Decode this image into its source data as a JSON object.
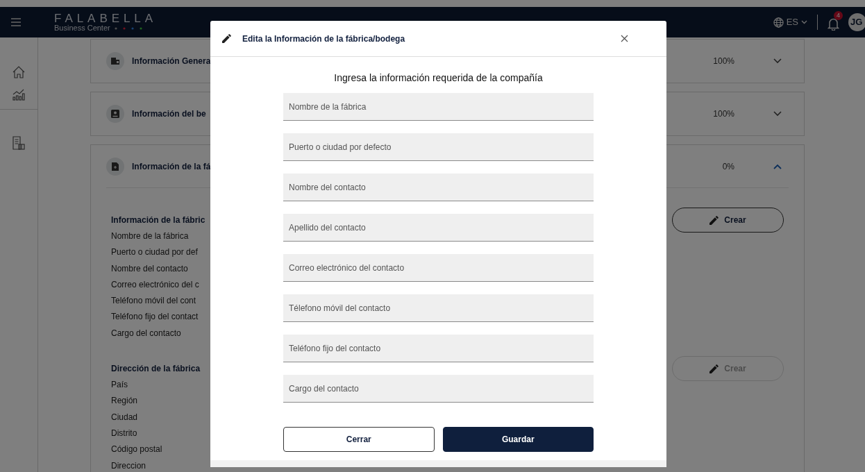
{
  "header": {
    "wordmark": "FALABELLA",
    "tagline": "Business Center",
    "language": "ES",
    "notifications": "4",
    "avatar": "JG"
  },
  "accordion": [
    {
      "title": "Información Genera",
      "progress": "100%",
      "expanded": false
    },
    {
      "title": "Información del be",
      "progress": "100%",
      "expanded": false
    },
    {
      "title": "Información de la fá",
      "progress": "0%",
      "expanded": true,
      "sections": [
        {
          "heading": "Información de la fábric",
          "rows": [
            "Nombre de la fábrica",
            "Puerto o ciudad por def",
            "Nombre del contacto",
            "Correo electrónico del c",
            "Teléfono móvil del cont",
            "Teléfono fijo del contact",
            "Cargo del contacto"
          ],
          "button": {
            "label": "Crear",
            "disabled": false
          }
        },
        {
          "heading": "Dirección de la fábrica",
          "rows": [
            "País",
            "Región",
            "Ciudad",
            "Distrito",
            "Código postal",
            "Direccion"
          ],
          "button": {
            "label": "Crear",
            "disabled": true
          }
        }
      ]
    }
  ],
  "modal": {
    "title": "Edita la Información de la fábrica/bodega",
    "subtitle": "Ingresa la información requerida de la compañía",
    "fields": [
      {
        "placeholder": "Nombre de la fábrica"
      },
      {
        "placeholder": "Puerto o ciudad por defecto"
      },
      {
        "placeholder": "Nombre del contacto"
      },
      {
        "placeholder": "Apellido del contacto"
      },
      {
        "placeholder": "Correo electrónico del contacto"
      },
      {
        "placeholder": "Télefono móvil del contacto"
      },
      {
        "placeholder": "Teléfono fijo del contacto"
      },
      {
        "placeholder": "Cargo del contacto"
      }
    ],
    "buttons": [
      {
        "label": "Cerrar",
        "kind": "secondary"
      },
      {
        "label": "Guardar",
        "kind": "primary"
      }
    ]
  }
}
